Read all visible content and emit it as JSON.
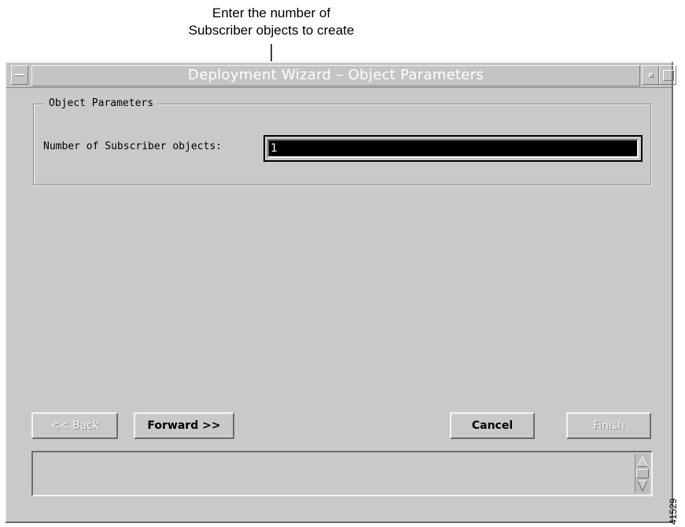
{
  "callout": {
    "line1": "Enter the number of",
    "line2": "Subscriber objects to create"
  },
  "window": {
    "title": "Deployment Wizard – Object Parameters",
    "titlebar_icons": [
      "window-menu-icon",
      "minimize-icon",
      "maximize-icon"
    ]
  },
  "group": {
    "legend": "Object Parameters",
    "field_label": "Number of Subscriber objects:",
    "field_value": "1"
  },
  "buttons": {
    "back": "<< Back",
    "forward": "Forward >>",
    "cancel": "Cancel",
    "finish": "Finish"
  },
  "status_area": {
    "text": ""
  },
  "figure_id": "41529",
  "colors": {
    "window_bg": "#c9c9c9",
    "title_text": "#ffffff",
    "field_bg": "#000000"
  }
}
